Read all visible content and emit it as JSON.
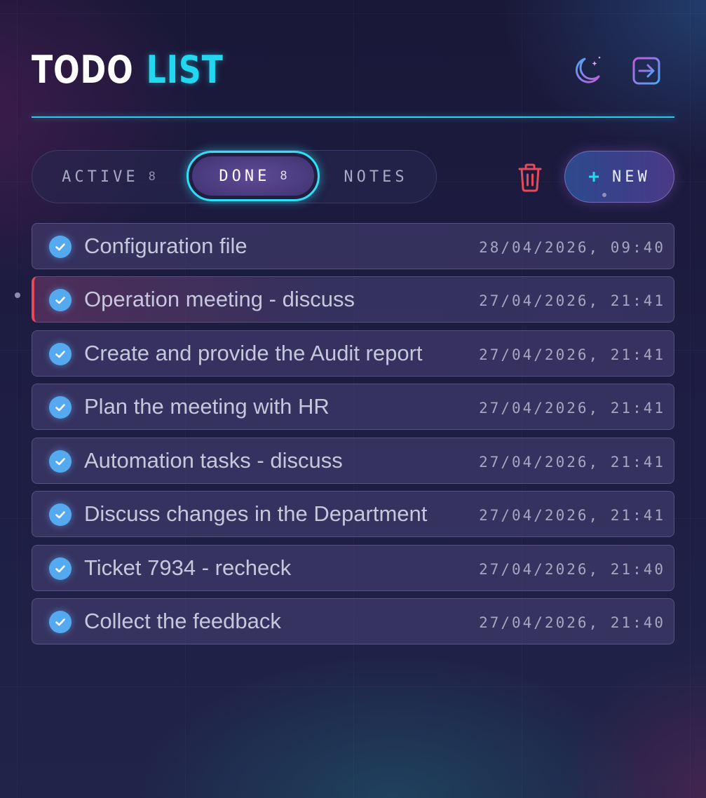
{
  "header": {
    "title_part1": "TODO",
    "title_part2": "LIST",
    "theme_icon": "moon-stars-icon",
    "logout_icon": "logout-arrow-icon"
  },
  "tabs": [
    {
      "label": "ACTIVE",
      "count": "8",
      "selected": false
    },
    {
      "label": "DONE",
      "count": "8",
      "selected": true
    },
    {
      "label": "NOTES",
      "count": "",
      "selected": false
    }
  ],
  "toolbar": {
    "trash_icon": "trash-icon",
    "new_plus": "+",
    "new_label": "NEW"
  },
  "tasks": [
    {
      "title": "Configuration file",
      "date": "28/04/2026, 09:40",
      "done": true
    },
    {
      "title": "Operation meeting - discuss",
      "date": "27/04/2026, 21:41",
      "done": true
    },
    {
      "title": "Create and provide the Audit report",
      "date": "27/04/2026, 21:41",
      "done": true
    },
    {
      "title": "Plan the meeting with HR",
      "date": "27/04/2026, 21:41",
      "done": true
    },
    {
      "title": "Automation tasks - discuss",
      "date": "27/04/2026, 21:41",
      "done": true
    },
    {
      "title": "Discuss changes in the Department",
      "date": "27/04/2026, 21:41",
      "done": true
    },
    {
      "title": "Ticket 7934 - recheck",
      "date": "27/04/2026, 21:40",
      "done": true
    },
    {
      "title": "Collect the feedback",
      "date": "27/04/2026, 21:40",
      "done": true
    }
  ],
  "colors": {
    "accent_cyan": "#22d8f0",
    "check_blue": "#55a9ef",
    "danger_red": "#e34a5a"
  }
}
